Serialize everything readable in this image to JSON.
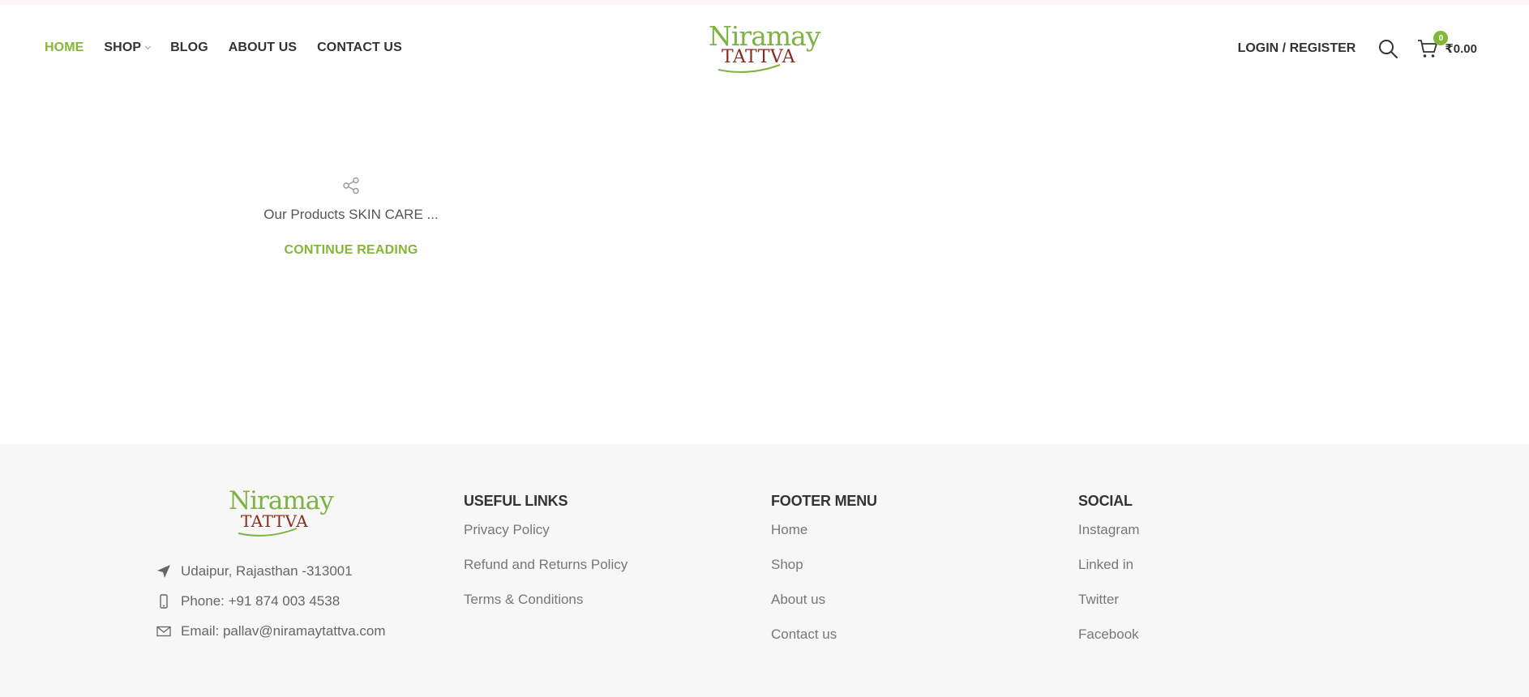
{
  "nav": {
    "items": [
      {
        "label": "HOME",
        "active": true
      },
      {
        "label": "SHOP",
        "has_dropdown": true
      },
      {
        "label": "BLOG"
      },
      {
        "label": "ABOUT US"
      },
      {
        "label": "CONTACT US"
      }
    ]
  },
  "logo": {
    "line1": "Niramay",
    "line2": "TATTVA"
  },
  "header": {
    "login_label": "LOGIN / REGISTER",
    "search_icon": "search-icon",
    "cart_icon": "cart-icon",
    "cart_count": "0",
    "cart_total": "₹0.00"
  },
  "post": {
    "share_icon": "share-icon",
    "excerpt": "Our Products SKIN CARE ...",
    "read_more": "CONTINUE READING"
  },
  "footer": {
    "contact": [
      {
        "icon": "location-arrow-icon",
        "text": "Udaipur, Rajasthan -313001"
      },
      {
        "icon": "phone-icon",
        "text": "Phone: +91 874 003 4538"
      },
      {
        "icon": "email-icon",
        "text": "Email: pallav@niramaytattva.com"
      }
    ],
    "useful_links": {
      "title": "USEFUL LINKS",
      "items": [
        "Privacy Policy",
        "Refund and Returns Policy",
        "Terms & Conditions"
      ]
    },
    "footer_menu": {
      "title": "FOOTER MENU",
      "items": [
        "Home",
        "Shop",
        "About us",
        "Contact us"
      ]
    },
    "social": {
      "title": "SOCIAL",
      "items": [
        "Instagram",
        "Linked in",
        "Twitter",
        "Facebook"
      ]
    }
  },
  "colors": {
    "accent": "#83b735",
    "logo_green": "#7cb342",
    "logo_red": "#8b2b1e",
    "footer_bg": "#f7f7f7"
  }
}
